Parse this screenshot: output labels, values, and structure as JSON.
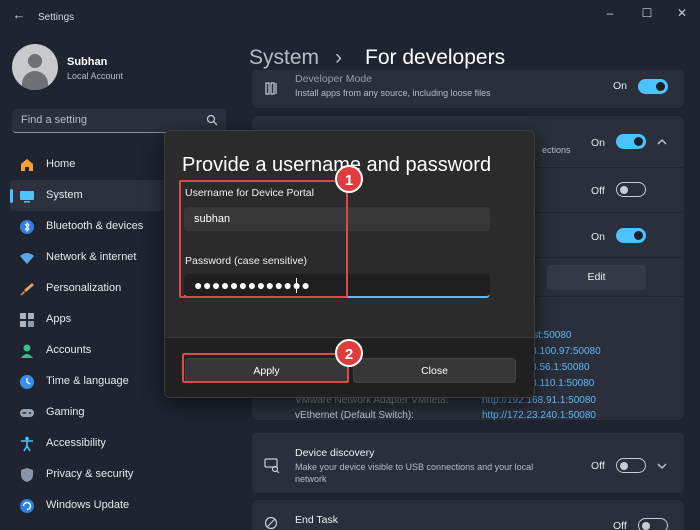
{
  "window": {
    "title": "Settings"
  },
  "user": {
    "name": "Subhan",
    "account_type": "Local Account"
  },
  "search": {
    "placeholder": "Find a setting"
  },
  "sidebar": {
    "items": [
      {
        "label": "Home",
        "icon": "home-icon"
      },
      {
        "label": "System",
        "icon": "system-icon",
        "active": true
      },
      {
        "label": "Bluetooth & devices",
        "icon": "bluetooth-icon"
      },
      {
        "label": "Network & internet",
        "icon": "wifi-icon"
      },
      {
        "label": "Personalization",
        "icon": "brush-icon"
      },
      {
        "label": "Apps",
        "icon": "apps-icon"
      },
      {
        "label": "Accounts",
        "icon": "person-icon"
      },
      {
        "label": "Time & language",
        "icon": "globe-clock-icon"
      },
      {
        "label": "Gaming",
        "icon": "gamepad-icon"
      },
      {
        "label": "Accessibility",
        "icon": "accessibility-icon"
      },
      {
        "label": "Privacy & security",
        "icon": "shield-icon"
      },
      {
        "label": "Windows Update",
        "icon": "update-icon"
      }
    ]
  },
  "breadcrumb": {
    "parent": "System",
    "separator": "›",
    "current": "For developers"
  },
  "settings": {
    "developer_mode": {
      "title": "Developer Mode",
      "subtitle": "Install apps from any source, including loose files",
      "state": "On"
    },
    "device_portal": {
      "subtitle_fragment": "ections",
      "state": "On"
    },
    "row_off": {
      "state": "Off"
    },
    "row_on": {
      "state": "On"
    },
    "edit_label": "Edit",
    "adapters": [
      {
        "name": "",
        "url": "host:50080"
      },
      {
        "name": "",
        "url": "168.100.97:50080"
      },
      {
        "name": "",
        "url": "168.56.1:50080"
      },
      {
        "name": "",
        "url": "168.110.1:50080"
      },
      {
        "name": "VMware Network Adapter VMnet8:",
        "url": "http://192.168.91.1:50080"
      },
      {
        "name": "vEthernet (Default Switch):",
        "url": "http://172.23.240.1:50080"
      }
    ],
    "device_discovery": {
      "title": "Device discovery",
      "subtitle": "Make your device visible to USB connections and your local network",
      "state": "Off"
    },
    "end_task": {
      "title": "End Task",
      "state": "Off"
    }
  },
  "dialog": {
    "title": "Provide a username and password",
    "username_label": "Username for Device Portal",
    "username_value": "subhan",
    "password_label": "Password (case sensitive)",
    "password_value": "●●●●●●●●●●●●●",
    "apply_label": "Apply",
    "close_label": "Close"
  },
  "annotations": {
    "step1": "1",
    "step2": "2",
    "color": "#e0484b"
  },
  "colors": {
    "accent": "#4cc2ff",
    "background": "#1f2430",
    "card": "#2a2f3b"
  }
}
